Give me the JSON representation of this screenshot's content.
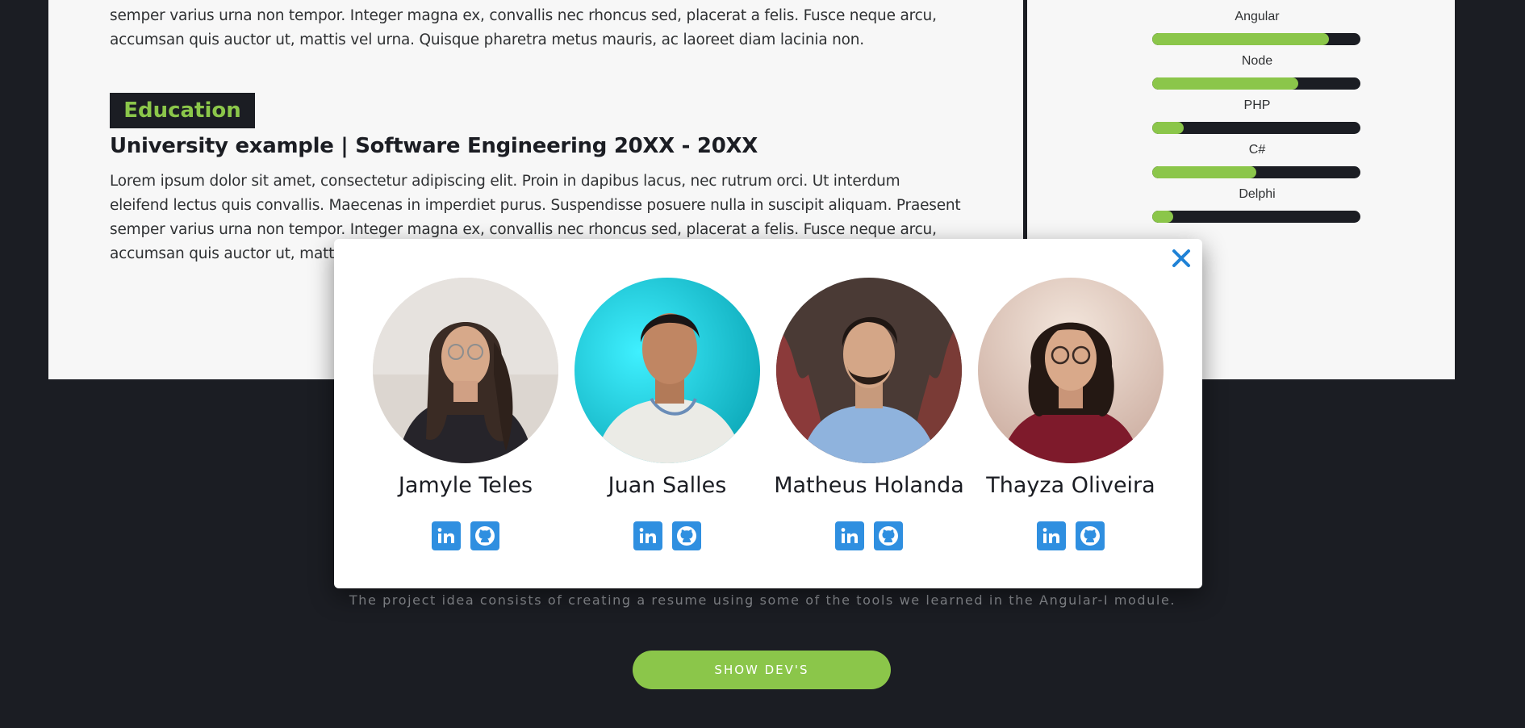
{
  "resume": {
    "top_paragraph_lines": [
      "semper varius urna non tempor. Integer magna ex, convallis nec rhoncus sed, placerat a felis. Fusce neque arcu,",
      "accumsan quis auctor ut, mattis vel urna. Quisque pharetra metus mauris, ac laoreet diam lacinia non."
    ],
    "education_heading": "Education",
    "education_title": "University example | Software Engineering 20XX - 20XX",
    "education_paragraph_lines": [
      "Lorem ipsum dolor sit amet, consectetur adipiscing elit. Proin in dapibus lacus, nec rutrum orci. Ut interdum",
      "eleifend lectus quis convallis. Maecenas in imperdiet purus. Suspendisse posuere nulla in suscipit aliquam. Praesent",
      "semper varius urna non tempor. Integer magna ex, convallis nec rhoncus sed, placerat a felis. Fusce neque arcu,",
      "accumsan quis auctor ut, mattis"
    ]
  },
  "skills": [
    {
      "name": "Angular",
      "level": 0.85
    },
    {
      "name": "Node",
      "level": 0.7
    },
    {
      "name": "PHP",
      "level": 0.15
    },
    {
      "name": "C#",
      "level": 0.5
    },
    {
      "name": "Delphi",
      "level": 0.1
    }
  ],
  "footer": {
    "description": "The project idea consists of creating a resume using some of the tools we learned in the Angular-I module.",
    "show_button": "SHOW DEV'S"
  },
  "modal": {
    "close_icon": "close-icon",
    "developers": [
      {
        "name": "Jamyle Teles",
        "social": [
          "linkedin-icon",
          "github-icon"
        ]
      },
      {
        "name": "Juan Salles",
        "social": [
          "linkedin-icon",
          "github-icon"
        ]
      },
      {
        "name": "Matheus Holanda",
        "social": [
          "linkedin-icon",
          "github-icon"
        ]
      },
      {
        "name": "Thayza Oliveira",
        "social": [
          "linkedin-icon",
          "github-icon"
        ]
      }
    ]
  },
  "colors": {
    "accent": "#8bc64a",
    "dark": "#1b1d23",
    "social_blue": "#2f8fe0",
    "close_blue": "#1f82d6"
  }
}
